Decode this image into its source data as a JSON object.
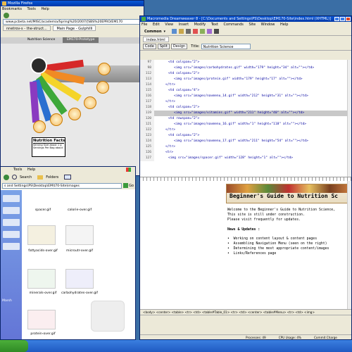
{
  "browser": {
    "title": "Mozilla Firefox",
    "menu": [
      "Bookmarks",
      "Tools",
      "Help"
    ],
    "url": "www.pcbeta.net/MISC/academia/Spring%20/2007/[SBS%20EPRO/EM170",
    "tabs": [
      "nnetrov-s - the-struct...",
      "Main Page - Gulphilli"
    ],
    "page_tabs": [
      "Nutrition Science",
      "EM170-Prototype"
    ],
    "nutrition_facts": {
      "heading": "Nutrition Facts",
      "line1": "Serving Size    about 1 g",
      "line2": "Servings Per Bag  about"
    }
  },
  "explorer": {
    "menu": [
      "Tools",
      "Help"
    ],
    "search_label": "Search",
    "folders_label": "Folders",
    "address": "s and Settings\\PS\\Desktop\\EM\\t70-Site\\images",
    "go_label": "Go",
    "left_labels": [
      "",
      "",
      "",
      "",
      "",
      "",
      "",
      "Marsh"
    ],
    "files": [
      {
        "name": "spacer.gif"
      },
      {
        "name": "calorie-over.gif"
      },
      {
        "name": "fattyacids-over.gif"
      },
      {
        "name": "microutr-over.gif"
      },
      {
        "name": "minerals-over.gif"
      },
      {
        "name": "carbohydrates-over.gif"
      },
      {
        "name": "protein-over.gif"
      }
    ]
  },
  "editor": {
    "title": "Macromedia Dreamweaver 8 - [C:\\Documents and Settings\\PS\\Desktop\\EM170-Site\\index.html (XHTML)]",
    "menu": [
      "File",
      "Edit",
      "View",
      "Insert",
      "Modify",
      "Text",
      "Commands",
      "Site",
      "Window",
      "Help"
    ],
    "insert_label": "Common",
    "doc_tab": "index.html",
    "view_buttons": [
      "Code",
      "Split",
      "Design"
    ],
    "title_label": "Title:",
    "title_value": "Nutrition Science",
    "code_lines": [
      {
        "num": "97",
        "text": "<td colspan=\"2\">"
      },
      {
        "num": "98",
        "text": "<img src=\"images/carbohydrates.gif\" width=\"179\" height=\"34\" alt=\"\"></td>"
      },
      {
        "num": "112",
        "text": "<td colspan=\"2\">"
      },
      {
        "num": "113",
        "text": "<img src=\"images/protein.gif\" width=\"179\" height=\"17\" alt=\"\"></td>"
      },
      {
        "num": "114",
        "text": "</tr>"
      },
      {
        "num": "115",
        "text": "<td colspan=\"4\">"
      },
      {
        "num": "116",
        "text": "<img src=\"images/navmenu_14.gif\" width=\"212\" height=\"31\" alt=\"\"></td>"
      },
      {
        "num": "117",
        "text": "</tr>"
      },
      {
        "num": "118",
        "text": "<td colspan=\"2\">"
      },
      {
        "num": "119",
        "text": "<img src=\"images/vitamins.gif\" width=\"211\" height=\"40\" alt=\"\"></td>"
      },
      {
        "num": "120",
        "text": "<td rowspan=\"2\">"
      },
      {
        "num": "121",
        "text": "<img src=\"images/navmenu_16.gif\" width=\"1\" height=\"118\" alt=\"\"></td>"
      },
      {
        "num": "122",
        "text": "</tr>"
      },
      {
        "num": "123",
        "text": "<td colspan=\"2\">"
      },
      {
        "num": "124",
        "text": "<img src=\"images/navmenu_17.gif\" width=\"211\" height=\"54\" alt=\"\"></td>"
      },
      {
        "num": "125",
        "text": "</tr>"
      },
      {
        "num": "126",
        "text": "<tr>"
      },
      {
        "num": "127",
        "text": "<img src=\"images/spacer.gif\" width=\"128\" height=\"1\" alt=\"\"></td>"
      }
    ],
    "design": {
      "banner": "Beginner's Guide to Nutrition Sc",
      "welcome": [
        "Welcome to the Beginner's Guide to Nutrition Science,",
        "This site is still under construction.",
        "Please visit frequently for updates."
      ],
      "news_heading": "News & Updates :",
      "news_items": [
        "Working on content layout & content pages",
        "Assembling Navigation Menu (seen on the right)",
        "Determining the most appropriate content/images",
        "Links/References page"
      ]
    },
    "tag_selector": "<body> <center> <table> <tr> <td> <table#Table_01> <tr> <td> <center> <table#Menu> <tr> <td> <img>",
    "status": {
      "processes": "Processes: 49",
      "cpu": "CPU Usage: 4%",
      "commit": "Commit Charge"
    }
  },
  "colors": {
    "desktop": "#3a6ea5",
    "titlebar": "#0a58d8",
    "chrome": "#ece9d8",
    "highlight": "#c8c8c8"
  }
}
